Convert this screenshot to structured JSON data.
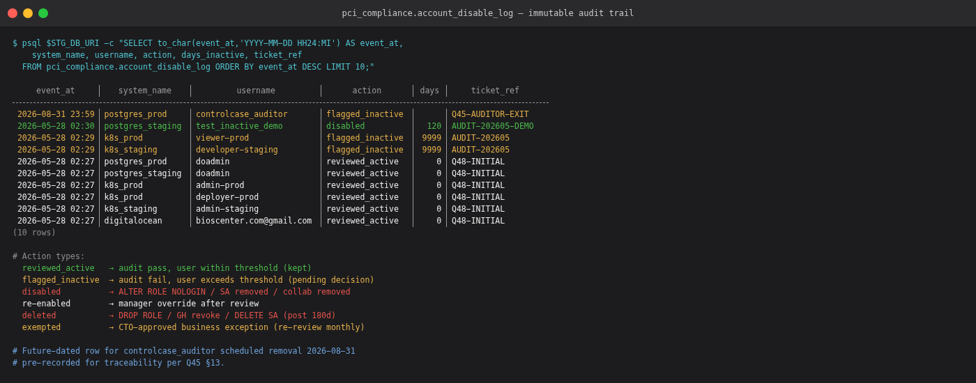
{
  "window": {
    "title": "pci_compliance.account_disable_log — immutable audit trail"
  },
  "command": [
    "$ psql $STG_DB_URI −c \"SELECT to_char(event_at,'YYYY−MM−DD HH24:MI') AS event_at,",
    "system_name, username, action, days_inactive, ticket_ref",
    "FROM pci_compliance.account_disable_log ORDER BY event_at DESC LIMIT 10;\""
  ],
  "table": {
    "columns": [
      "event_at",
      "system_name",
      "username",
      "action",
      "days",
      "ticket_ref"
    ],
    "rows": [
      {
        "event_at": "2026−08−31 23:59",
        "system_name": "postgres_prod",
        "username": "controlcase_auditor",
        "action": "flagged_inactive",
        "ticket_ref": "Q45−AUDITOR−EXIT",
        "color": "#e5b04a"
      },
      {
        "event_at": "2026−05−28 02:30",
        "system_name": "postgres_staging",
        "username": "test_inactive_demo",
        "action": "disabled",
        "days": "120",
        "ticket_ref": "AUDIT−202605−DEMO",
        "color": "#4cbb4c"
      },
      {
        "event_at": "2026−05−28 02:29",
        "system_name": "k8s_prod",
        "username": "viewer−prod",
        "action": "flagged_inactive",
        "days": "9999",
        "ticket_ref": "AUDIT−202605",
        "color": "#e5b04a"
      },
      {
        "event_at": "2026−05−28 02:29",
        "system_name": "k8s_staging",
        "username": "developer−staging",
        "action": "flagged_inactive",
        "days": "9999",
        "ticket_ref": "AUDIT−202605",
        "color": "#e5b04a"
      },
      {
        "event_at": "2026−05−28 02:27",
        "system_name": "postgres_prod",
        "username": "doadmin",
        "action": "reviewed_active",
        "days": "0",
        "ticket_ref": "Q48−INITIAL",
        "color": "#ececec"
      },
      {
        "event_at": "2026−05−28 02:27",
        "system_name": "postgres_staging",
        "username": "doadmin",
        "action": "reviewed_active",
        "days": "0",
        "ticket_ref": "Q48−INITIAL",
        "color": "#ececec"
      },
      {
        "event_at": "2026−05−28 02:27",
        "system_name": "k8s_prod",
        "username": "admin−prod",
        "action": "reviewed_active",
        "days": "0",
        "ticket_ref": "Q48−INITIAL",
        "color": "#ececec"
      },
      {
        "event_at": "2026−05−28 02:27",
        "system_name": "k8s_prod",
        "username": "deployer−prod",
        "action": "reviewed_active",
        "days": "0",
        "ticket_ref": "Q48−INITIAL",
        "color": "#ececec"
      },
      {
        "event_at": "2026−05−28 02:27",
        "system_name": "k8s_staging",
        "username": "admin−staging",
        "action": "reviewed_active",
        "days": "0",
        "ticket_ref": "Q48−INITIAL",
        "color": "#ececec"
      },
      {
        "event_at": "2026−05−28 02:27",
        "system_name": "digitalocean",
        "username": "bioscenter.com@gmail.com",
        "action": "reviewed_active",
        "days": "0",
        "ticket_ref": "Q48−INITIAL",
        "color": "#ececec"
      }
    ],
    "footer": "(10 rows)"
  },
  "legend": {
    "title": "# Action types:",
    "items": [
      {
        "action": "reviewed_active",
        "description": "→ audit pass, user within threshold (kept)",
        "color": "#4cbb4c"
      },
      {
        "action": "flagged_inactive",
        "description": "→ audit fail, user exceeds threshold (pending decision)",
        "color": "#e5b04a"
      },
      {
        "action": "disabled",
        "description": "→ ALTER ROLE NOLOGIN / SA removed / collab removed",
        "color": "#e5534b"
      },
      {
        "action": "re−enabled",
        "description": "→ manager override after review",
        "color": "#ececec"
      },
      {
        "action": "deleted",
        "description": "→ DROP ROLE / GH revoke / DELETE SA (post 180d)",
        "color": "#e5534b"
      },
      {
        "action": "exempted",
        "description": "→ CTO−approved business exception (re−review monthly)",
        "color": "#e5b04a"
      }
    ]
  },
  "comments": [
    "# Future−dated row for controlcase_auditor scheduled removal 2026−08−31",
    "# pre−recorded for traceability per Q45 §13."
  ]
}
